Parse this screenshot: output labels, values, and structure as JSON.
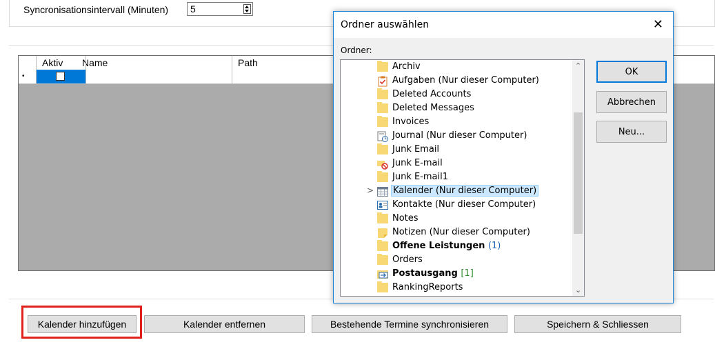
{
  "settings": {
    "interval_label": "Syncronisationsintervall (Minuten)",
    "interval_value": "5"
  },
  "grid": {
    "columns": [
      "Aktiv",
      "Name",
      "Path"
    ],
    "new_row_marker": "•"
  },
  "buttons": {
    "add_calendar": "Kalender hinzufügen",
    "remove_calendar": "Kalender entfernen",
    "sync_existing": "Bestehende Termine synchronisieren",
    "save_close": "Speichern & Schliessen"
  },
  "dialog": {
    "title": "Ordner auswählen",
    "folder_label": "Ordner:",
    "close_glyph": "✕",
    "ok": "OK",
    "cancel": "Abbrechen",
    "new": "Neu...",
    "folders": [
      {
        "name": "Archiv",
        "icon": "folder-icon"
      },
      {
        "name": "Aufgaben (Nur dieser Computer)",
        "icon": "tasks-icon"
      },
      {
        "name": "Deleted Accounts",
        "icon": "folder-icon"
      },
      {
        "name": "Deleted Messages",
        "icon": "folder-icon"
      },
      {
        "name": "Invoices",
        "icon": "folder-icon"
      },
      {
        "name": "Journal (Nur dieser Computer)",
        "icon": "journal-icon"
      },
      {
        "name": "Junk Email",
        "icon": "folder-icon"
      },
      {
        "name": "Junk E-mail",
        "icon": "junk-icon"
      },
      {
        "name": "Junk E-mail1",
        "icon": "folder-icon"
      },
      {
        "name": "Kalender (Nur dieser Computer)",
        "icon": "calendar-icon",
        "selected": true
      },
      {
        "name": "Kontakte (Nur dieser Computer)",
        "icon": "contacts-icon"
      },
      {
        "name": "Notes",
        "icon": "folder-icon"
      },
      {
        "name": "Notizen (Nur dieser Computer)",
        "icon": "notes-icon"
      },
      {
        "name": "Offene Leistungen",
        "count": "(1)",
        "icon": "folder-icon"
      },
      {
        "name": "Orders",
        "icon": "folder-icon"
      },
      {
        "name": "Postausgang",
        "count": "[1]",
        "icon": "outbox-icon"
      },
      {
        "name": "RankingReports",
        "icon": "folder-icon"
      }
    ]
  },
  "colors": {
    "selection_blue": "#0078d7",
    "highlight_red": "#e0201a",
    "folder_yellow": "#f8d775"
  }
}
